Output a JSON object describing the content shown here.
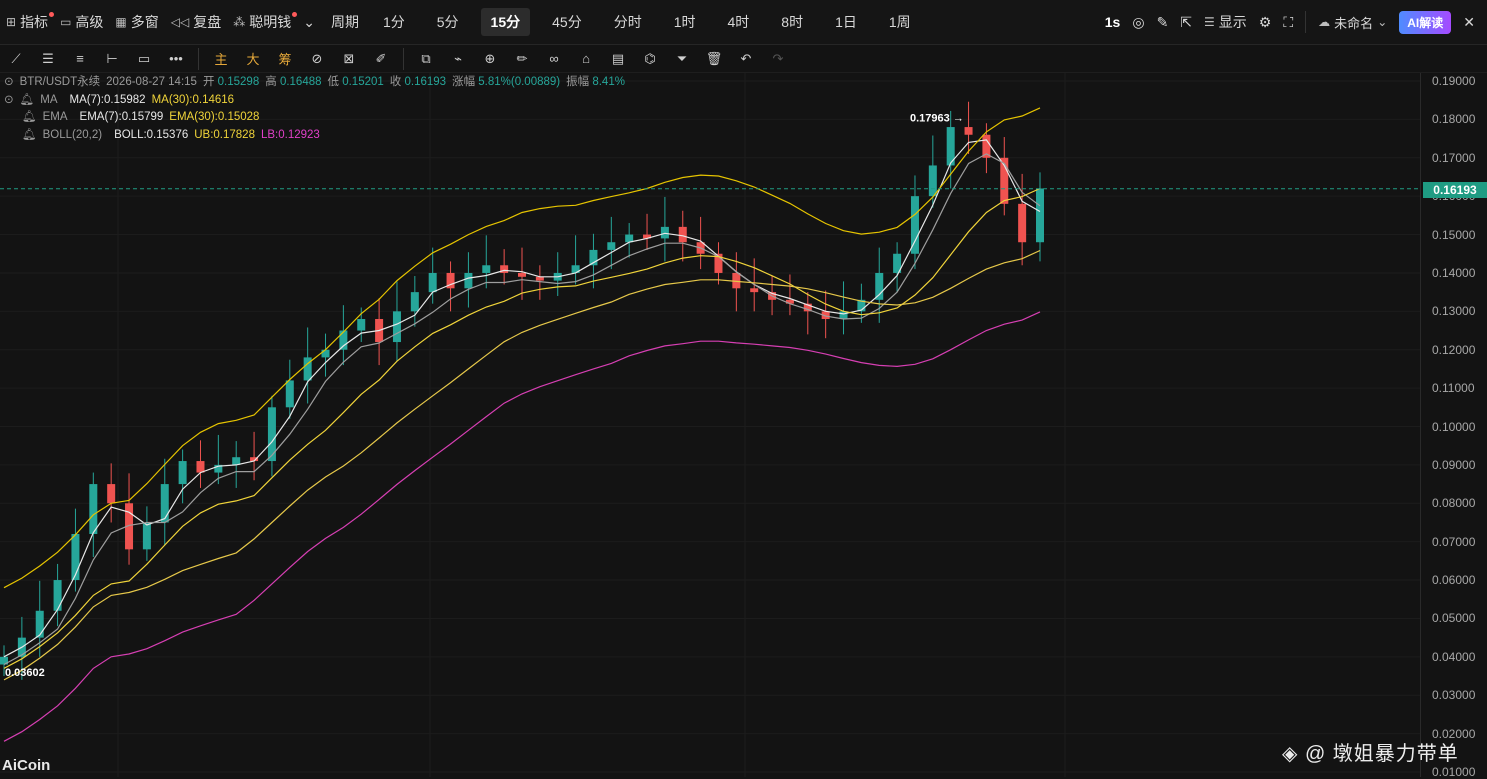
{
  "topbar": {
    "left_items": [
      {
        "icon": "indicator-icon",
        "glyph": "⊞",
        "label": "指标",
        "dot": true
      },
      {
        "icon": "layout-icon",
        "glyph": "▭",
        "label": "高级",
        "dot": false
      },
      {
        "icon": "multi-window-icon",
        "glyph": "▦",
        "label": "多窗",
        "dot": false
      },
      {
        "icon": "replay-icon",
        "glyph": "◁◁",
        "label": "复盘",
        "dot": false
      },
      {
        "icon": "smart-money-icon",
        "glyph": "⁂",
        "label": "聪明钱",
        "dot": true
      }
    ],
    "period_label": "周期",
    "periods": [
      "1分",
      "5分",
      "15分",
      "45分",
      "分时",
      "1时",
      "4时",
      "8时",
      "1日",
      "1周"
    ],
    "active_period": "15分",
    "right": {
      "interval": "1s",
      "display_label": "显示",
      "layout_name": "未命名",
      "ai_label": "AI解读"
    }
  },
  "toolbar": {
    "tools": [
      "line-tool-icon",
      "hline-tool-icon",
      "channel-tool-icon",
      "ray-tool-icon",
      "rect-tool-icon",
      "more-tool-icon"
    ],
    "labels": [
      "主",
      "大",
      "筹"
    ]
  },
  "legend": {
    "symbol": "BTR/USDT永续",
    "datetime": "2026-08-27 14:15",
    "open_label": "开",
    "open": "0.15298",
    "high_label": "高",
    "high": "0.16488",
    "low_label": "低",
    "low": "0.15201",
    "close_label": "收",
    "close": "0.16193",
    "change_label": "涨幅",
    "change": "5.81%(0.00889)",
    "amp_label": "振幅",
    "amp": "8.41%",
    "ma_name": "MA",
    "ma7": "MA(7):0.15982",
    "ma30": "MA(30):0.14616",
    "ema_name": "EMA",
    "ema7": "EMA(7):0.15799",
    "ema30": "EMA(30):0.15028",
    "boll_name": "BOLL(20,2)",
    "boll": "BOLL:0.15376",
    "ub": "UB:0.17828",
    "lb": "LB:0.12923"
  },
  "price_axis": {
    "ticks": [
      "0.19000",
      "0.18000",
      "0.17000",
      "0.16000",
      "0.15000",
      "0.14000",
      "0.13000",
      "0.12000",
      "0.11000",
      "0.10000",
      "0.09000",
      "0.08000",
      "0.07000",
      "0.06000",
      "0.05000",
      "0.04000",
      "0.03000",
      "0.02000",
      "0.01000"
    ],
    "current": "0.16193"
  },
  "annotations": {
    "high_mark": "0.17963 →",
    "low_mark": "0.03602"
  },
  "chart_data": {
    "type": "candlestick",
    "symbol": "BTR/USDT永续",
    "interval": "15分",
    "ylim": [
      0.01,
      0.19
    ],
    "last_price": 0.16193,
    "period_high": 0.17963,
    "period_low": 0.03602,
    "close_trend": [
      0.04,
      0.045,
      0.052,
      0.06,
      0.072,
      0.085,
      0.08,
      0.068,
      0.075,
      0.085,
      0.091,
      0.088,
      0.09,
      0.092,
      0.091,
      0.105,
      0.112,
      0.118,
      0.12,
      0.125,
      0.128,
      0.122,
      0.13,
      0.135,
      0.14,
      0.136,
      0.14,
      0.142,
      0.14,
      0.139,
      0.138,
      0.14,
      0.142,
      0.146,
      0.148,
      0.15,
      0.149,
      0.152,
      0.148,
      0.145,
      0.14,
      0.136,
      0.135,
      0.133,
      0.132,
      0.13,
      0.128,
      0.13,
      0.133,
      0.14,
      0.145,
      0.16,
      0.168,
      0.178,
      0.176,
      0.17,
      0.158,
      0.148,
      0.162
    ]
  },
  "watermark": "◈ @ 墩姐暴力带单",
  "logo": "AiCoin"
}
